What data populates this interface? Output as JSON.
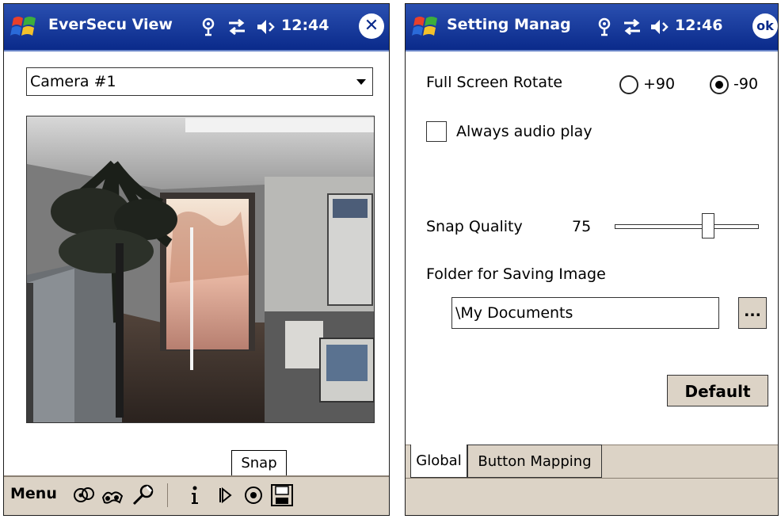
{
  "left_window": {
    "title": "EverSecu View",
    "clock": "12:44",
    "close_symbol": "✕",
    "camera_select": {
      "selected": "Camera #1"
    },
    "tooltip": "Snap",
    "menubar": {
      "menu_label": "Menu",
      "icons": [
        "cameras-icon",
        "binoculars-icon",
        "wrench-icon",
        "info-icon",
        "play-icon",
        "record-icon",
        "save-icon"
      ]
    }
  },
  "right_window": {
    "title": "Setting Manag",
    "clock": "12:46",
    "ok_label": "ok",
    "full_screen_rotate": {
      "label": "Full Screen Rotate",
      "options": [
        {
          "label": "+90",
          "selected": false
        },
        {
          "label": "-90",
          "selected": true
        }
      ]
    },
    "always_audio_play": {
      "label": "Always audio play",
      "checked": false
    },
    "snap_quality": {
      "label": "Snap Quality",
      "value": "75",
      "slider_fraction": 0.66
    },
    "folder": {
      "label": "Folder for Saving Image",
      "value": "\\My Documents",
      "browse_label": "..."
    },
    "default_button": "Default",
    "tabs": [
      {
        "label": "Global",
        "active": true
      },
      {
        "label": "Button Mapping",
        "active": false
      }
    ]
  },
  "colors": {
    "titlebar": "#0a2a8a",
    "chrome": "#dcd3c6"
  }
}
